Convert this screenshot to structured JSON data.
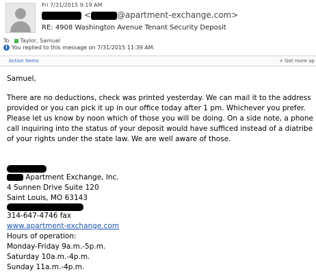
{
  "header": {
    "date": "Fri 7/31/2015 9:19 AM",
    "from_suffix": "@apartment-exchange.com>",
    "from_prefix": "<",
    "subject": "RE: 4908 Washington Avenue Tenant Security Deposit",
    "to_label": "To",
    "to_name": "Taylor, Samuel",
    "replied_notice": "You replied to this message on 7/31/2015 11:39 AM."
  },
  "actionbar": {
    "action_items": "Action Items",
    "get_more": "+ Get more ap"
  },
  "body": {
    "greeting": "Samuel,",
    "paragraph": "There are no deductions, check was printed yesterday.  We can mail it to the address provided or you can pick it up in our office today after 1 pm. Whichever you prefer.  Please let us know by noon which of those you will be doing.  On a side note, a phone call inquiring into the status of your deposit would have sufficed instead of a diatribe of your rights under the state law. We are well aware of those."
  },
  "signature": {
    "company": " Apartment Exchange, Inc.",
    "address1": "4 Sunnen Drive Suite 120",
    "address2": "Saint Louis, MO 63143",
    "fax": "314-647-4746 fax",
    "website": "www.apartment-exchange.com",
    "hours_title": "Hours of operation:",
    "hours_weekday": "Monday-Friday 9a.m.-5p.m.",
    "hours_saturday": "Saturday 10a.m.-4p.m.",
    "hours_sunday": "Sunday 11a.m.-4p.m."
  },
  "colors": {
    "link": "#1a55b0",
    "accent": "#2a6bb5",
    "redaction": "#000000"
  },
  "icons": {
    "avatar": "person-silhouette",
    "info": "info-icon",
    "recipient": "green-square-status"
  }
}
